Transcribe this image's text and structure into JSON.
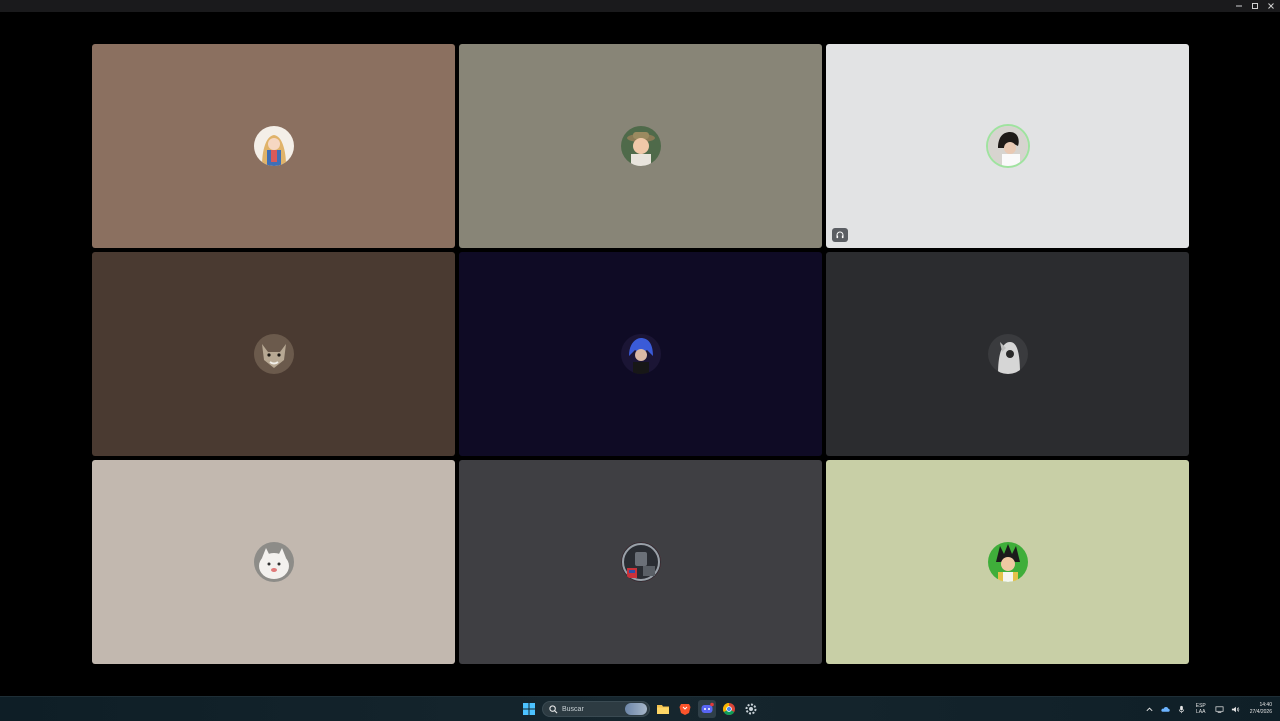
{
  "window": {
    "controls": [
      {
        "name": "minimize-button",
        "glyph": "—"
      },
      {
        "name": "maximize-button",
        "glyph": "☐"
      },
      {
        "name": "close-button",
        "glyph": "✕"
      }
    ]
  },
  "call": {
    "tiles": [
      {
        "bg": "#8b7060",
        "avatar": "anime-girl-avatar"
      },
      {
        "bg": "#888577",
        "avatar": "man-with-hat-avatar"
      },
      {
        "bg": "#e2e3e4",
        "avatar": "person-dark-hair-avatar",
        "speaking": true,
        "status_icon": "headphones-icon"
      },
      {
        "bg": "#4a3a31",
        "avatar": "wolf-avatar"
      },
      {
        "bg": "#0f0b25",
        "avatar": "blue-hair-character-avatar"
      },
      {
        "bg": "#2b2c2f",
        "avatar": "hooded-figure-avatar"
      },
      {
        "bg": "#c2b8af",
        "avatar": "white-cat-avatar"
      },
      {
        "bg": "#3f3f43",
        "avatar": "robot-emblem-avatar"
      },
      {
        "bg": "#c8cfa6",
        "avatar": "vegeta-avatar"
      }
    ]
  },
  "taskbar": {
    "search": {
      "placeholder": "Buscar"
    },
    "apps": [
      "windows-start-icon",
      "file-explorer-icon",
      "brave-browser-icon",
      "discord-icon",
      "chrome-icon",
      "settings-icon"
    ],
    "tray": {
      "lang_top": "ESP",
      "lang_bottom": "LAA",
      "time": "14:40",
      "date": "27/4/2026"
    }
  }
}
